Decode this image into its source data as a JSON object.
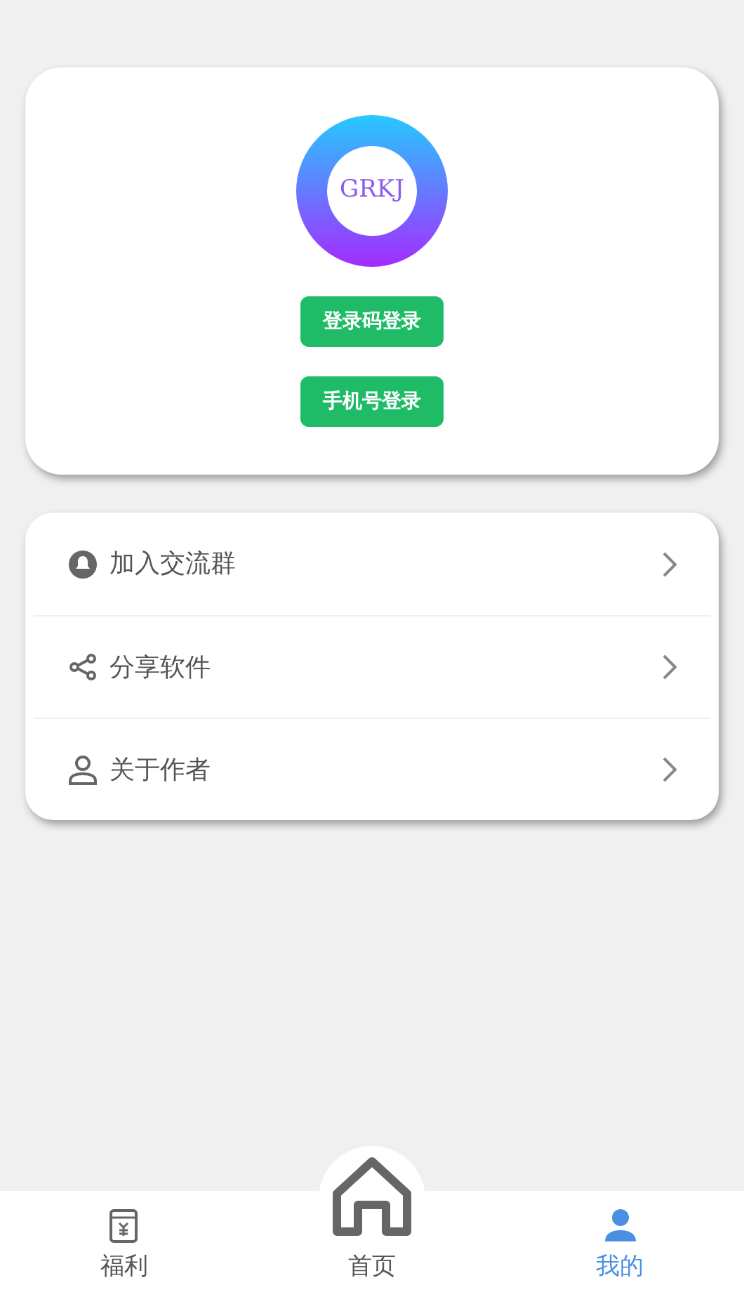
{
  "profile": {
    "logo_text": "GRKJ",
    "buttons": [
      "登录码登录",
      "手机号登录"
    ]
  },
  "menu": [
    {
      "kind": "group",
      "label": "加入交流群"
    },
    {
      "kind": "share",
      "label": "分享软件"
    },
    {
      "kind": "author",
      "label": "关于作者"
    }
  ],
  "tab_bar": [
    {
      "kind": "welfare",
      "label": "福利",
      "selected": false
    },
    {
      "kind": "home",
      "label": "首页",
      "selected": false
    },
    {
      "kind": "me",
      "label": "我的",
      "selected": true
    }
  ]
}
